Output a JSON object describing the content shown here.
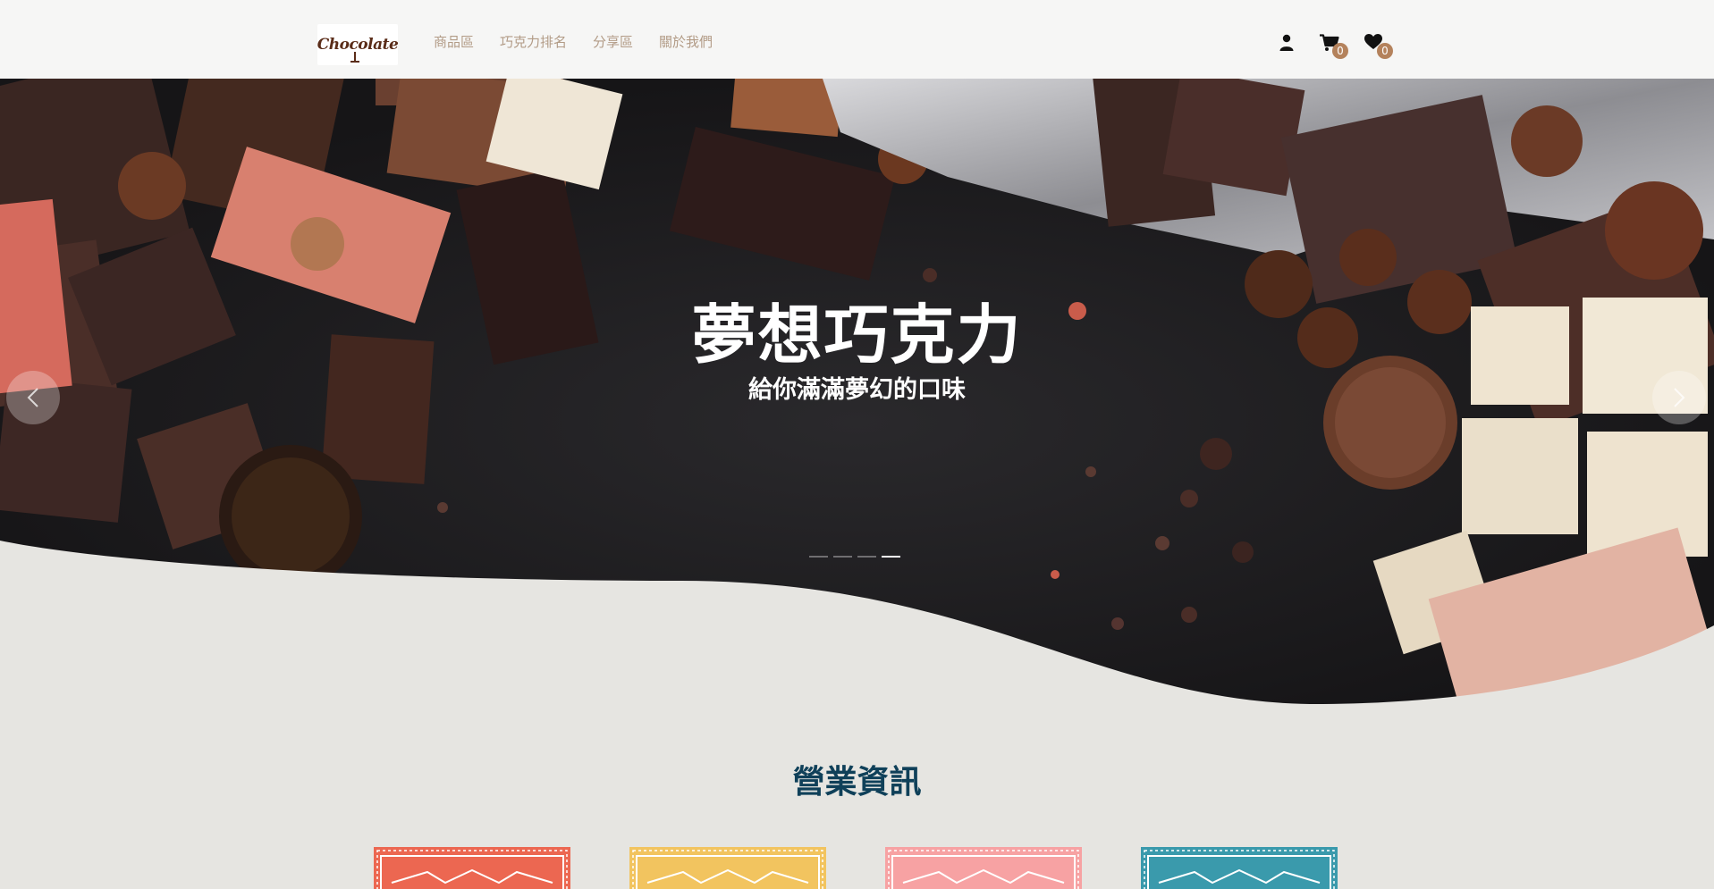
{
  "brand": {
    "logo_text": "Chocolate"
  },
  "nav": {
    "links": [
      "商品區",
      "巧克力排名",
      "分享區",
      "關於我們"
    ],
    "cart_count": "0",
    "wishlist_count": "0"
  },
  "hero": {
    "title": "夢想巧克力",
    "subtitle": "給你滿滿夢幻的口味",
    "slide_count": 4,
    "active_slide": 4
  },
  "section": {
    "title": "營業資訊"
  },
  "cards": [
    {
      "color": "#ec6751"
    },
    {
      "color": "#f2c45f"
    },
    {
      "color": "#f7a2a3"
    },
    {
      "color": "#3a9aac"
    }
  ],
  "colors": {
    "navbar_bg": "#f6f6f5",
    "nav_link": "#b29b86",
    "badge": "#b4825c",
    "page_bg": "#e6e5e1",
    "section_title": "#0f4059"
  }
}
